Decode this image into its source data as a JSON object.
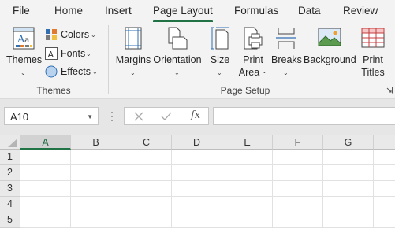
{
  "tabs": [
    {
      "label": "File",
      "active": false
    },
    {
      "label": "Home",
      "active": false
    },
    {
      "label": "Insert",
      "active": false
    },
    {
      "label": "Page Layout",
      "active": true
    },
    {
      "label": "Formulas",
      "active": false
    },
    {
      "label": "Data",
      "active": false
    },
    {
      "label": "Review",
      "active": false
    }
  ],
  "ribbon": {
    "themes_group": {
      "label": "Themes",
      "themes_button": "Themes",
      "colors": "Colors",
      "fonts": "Fonts",
      "effects": "Effects"
    },
    "page_setup_group": {
      "label": "Page Setup",
      "margins": "Margins",
      "orientation": "Orientation",
      "size": "Size",
      "print_area_1": "Print",
      "print_area_2": "Area",
      "breaks": "Breaks",
      "background": "Background",
      "print_titles_1": "Print",
      "print_titles_2": "Titles"
    }
  },
  "formula_bar": {
    "name_box": "A10",
    "formula": "",
    "fx_label": "fx"
  },
  "grid": {
    "columns": [
      "A",
      "B",
      "C",
      "D",
      "E",
      "F",
      "G"
    ],
    "rows": [
      "1",
      "2",
      "3",
      "4",
      "5"
    ],
    "selected_column": "A"
  },
  "colors": {
    "accent": "#217346",
    "ribbon_bg": "#f3f3f3",
    "header_bg": "#e9e9e9"
  }
}
